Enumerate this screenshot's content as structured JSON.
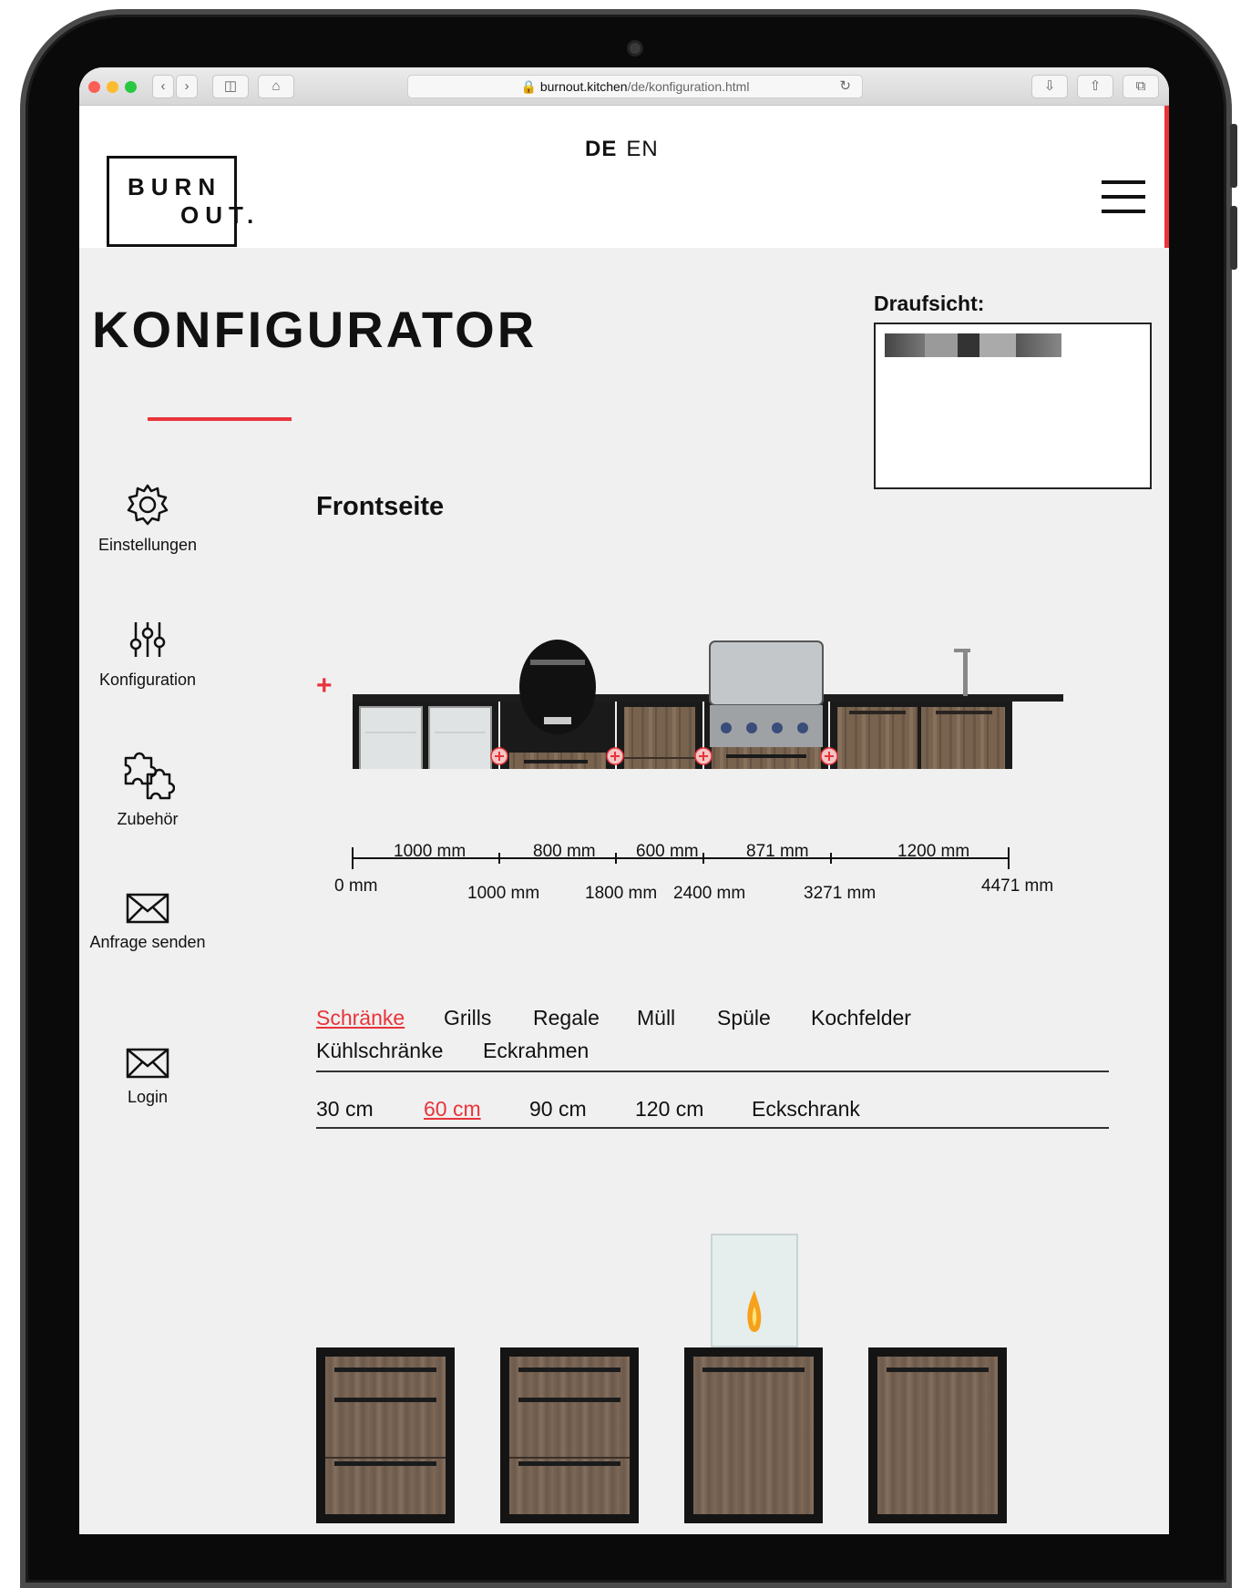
{
  "browser": {
    "url_host": "burnout.kitchen",
    "url_path": "/de/konfiguration.html"
  },
  "header": {
    "lang_de": "DE",
    "lang_en": "EN",
    "logo_line1": "BURN",
    "logo_line2": "OUT."
  },
  "page": {
    "title": "KONFIGURATOR",
    "draufsicht_label": "Draufsicht:",
    "frontseite_label": "Frontseite",
    "add_symbol": "+"
  },
  "sidebar": {
    "items": [
      {
        "label": "Einstellungen",
        "icon": "gear-icon"
      },
      {
        "label": "Konfiguration",
        "icon": "sliders-icon"
      },
      {
        "label": "Zubehör",
        "icon": "puzzle-icon"
      },
      {
        "label": "Anfrage senden",
        "icon": "envelope-icon"
      },
      {
        "label": "Login",
        "icon": "envelope-icon"
      }
    ]
  },
  "dimensions": {
    "segments": [
      "1000 mm",
      "800 mm",
      "600 mm",
      "871 mm",
      "1200 mm"
    ],
    "positions": [
      "0 mm",
      "1000 mm",
      "1800 mm",
      "2400 mm",
      "3271 mm",
      "4471 mm"
    ]
  },
  "categories": {
    "row1": [
      "Schränke",
      "Grills",
      "Regale",
      "Müll",
      "Spüle",
      "Kochfelder"
    ],
    "row2": [
      "Kühlschränke",
      "Eckrahmen"
    ],
    "active": "Schränke"
  },
  "sizes": {
    "items": [
      "30 cm",
      "60 cm",
      "90 cm",
      "120 cm",
      "Eckschrank"
    ],
    "active": "60 cm"
  },
  "colors": {
    "accent": "#e8343a",
    "text": "#111111",
    "background": "#f0f0f0"
  }
}
